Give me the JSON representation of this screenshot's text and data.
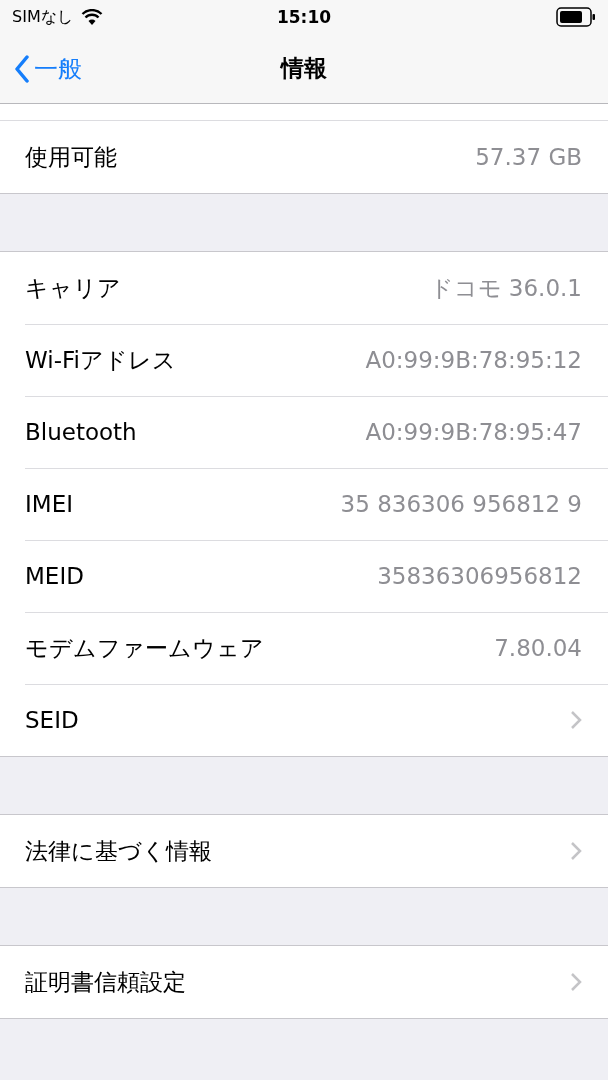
{
  "status_bar": {
    "carrier": "SIMなし",
    "time": "15:10"
  },
  "nav": {
    "back": "一般",
    "title": "情報"
  },
  "groups": [
    {
      "rows": [
        {
          "kind": "value",
          "label": "使用可能",
          "value": "57.37 GB"
        }
      ]
    },
    {
      "rows": [
        {
          "kind": "value",
          "label": "キャリア",
          "value": "ドコモ 36.0.1"
        },
        {
          "kind": "value",
          "label": "Wi-Fiアドレス",
          "value": "A0:99:9B:78:95:12"
        },
        {
          "kind": "value",
          "label": "Bluetooth",
          "value": "A0:99:9B:78:95:47"
        },
        {
          "kind": "value",
          "label": "IMEI",
          "value": "35 836306 956812 9"
        },
        {
          "kind": "value",
          "label": "MEID",
          "value": "35836306956812"
        },
        {
          "kind": "value",
          "label": "モデムファームウェア",
          "value": "7.80.04"
        },
        {
          "kind": "link",
          "label": "SEID"
        }
      ]
    },
    {
      "rows": [
        {
          "kind": "link",
          "label": "法律に基づく情報"
        }
      ]
    },
    {
      "rows": [
        {
          "kind": "link",
          "label": "証明書信頼設定"
        }
      ]
    }
  ]
}
